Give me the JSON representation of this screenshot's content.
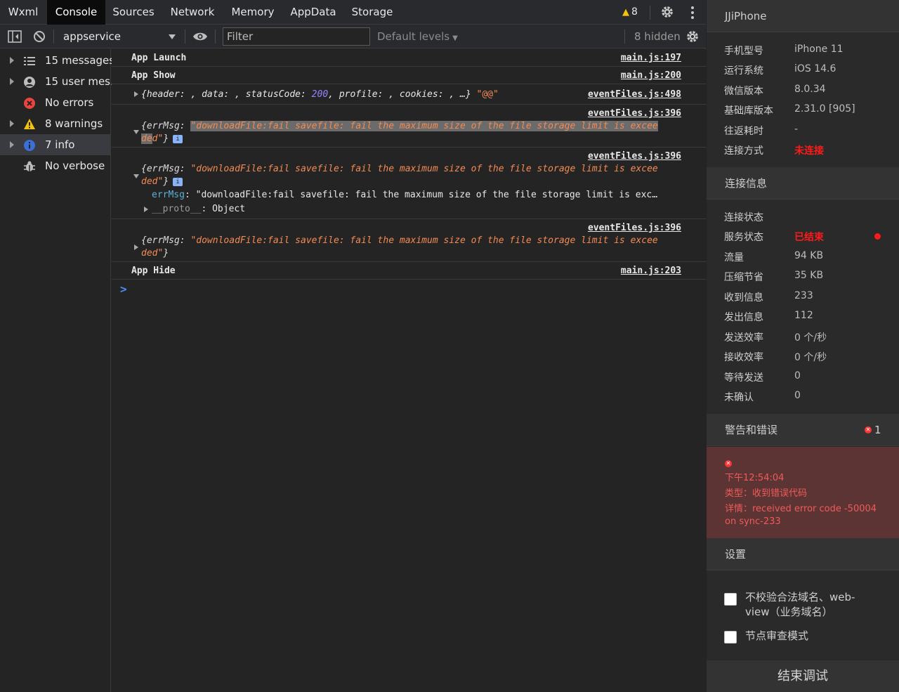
{
  "tabs": [
    "Wxml",
    "Console",
    "Sources",
    "Network",
    "Memory",
    "AppData",
    "Storage"
  ],
  "active_tab": "Console",
  "warning_count": "8",
  "toolbar": {
    "context": "appservice",
    "filter_placeholder": "Filter",
    "levels": "Default levels",
    "hidden": "8 hidden"
  },
  "sidebar": [
    {
      "label": "15 messages",
      "icon": "list-icon"
    },
    {
      "label": "15 user mes...",
      "icon": "user-icon"
    },
    {
      "label": "No errors",
      "icon": "error-icon"
    },
    {
      "label": "8 warnings",
      "icon": "warning-icon"
    },
    {
      "label": "7 info",
      "icon": "info-icon"
    },
    {
      "label": "No verbose",
      "icon": "bug-icon"
    }
  ],
  "log": {
    "launch": {
      "text": "App Launch",
      "src": "main.js:197"
    },
    "show": {
      "text": "App Show",
      "src": "main.js:200"
    },
    "obj": {
      "k1": "header",
      "k2": "data",
      "k3": "statusCode",
      "v3": "200",
      "k4": "profile",
      "k5": "cookies",
      "ell": "…",
      "str": "\"@@\"",
      "src": "eventFiles.js:498"
    },
    "err1": {
      "src": "eventFiles.js:396",
      "key": "{errMsg: ",
      "line1": "\"downloadFile:fail savefile: fail the maximum size of the file storage limit is excee",
      "line2a": "de",
      "line2b": "d\"",
      "close": "}",
      "badge": "i"
    },
    "err2": {
      "src": "eventFiles.js:396",
      "key": "{errMsg: ",
      "line1": "\"downloadFile:fail savefile: fail the maximum size of the file storage limit is excee",
      "line2": "ded\"",
      "close": "}",
      "badge": "i",
      "prop_key": "errMsg",
      "prop_val": "\"downloadFile:fail savefile: fail the maximum size of the file storage limit is exc…",
      "proto_key": "__proto__",
      "proto_val": "Object"
    },
    "err3": {
      "src": "eventFiles.js:396",
      "key": "{errMsg: ",
      "line1": "\"downloadFile:fail savefile: fail the maximum size of the file storage limit is excee",
      "line2": "ded\"",
      "close": "}"
    },
    "hide": {
      "text": "App Hide",
      "src": "main.js:203"
    },
    "prompt": ">"
  },
  "panel": {
    "device_title": "JJiPhone",
    "device_info": [
      {
        "k": "手机型号",
        "v": "iPhone 11"
      },
      {
        "k": "运行系统",
        "v": "iOS 14.6"
      },
      {
        "k": "微信版本",
        "v": "8.0.34"
      },
      {
        "k": "基础库版本",
        "v": "2.31.0 [905]"
      },
      {
        "k": "往返耗时",
        "v": "-"
      },
      {
        "k": "连接方式",
        "v": "未连接"
      }
    ],
    "conn_title": "连接信息",
    "conn_info": [
      {
        "k": "连接状态",
        "v": ""
      },
      {
        "k": "服务状态",
        "v": "已结束"
      },
      {
        "k": "流量",
        "v": "94 KB"
      },
      {
        "k": "压缩节省",
        "v": "35 KB"
      },
      {
        "k": "收到信息",
        "v": "233"
      },
      {
        "k": "发出信息",
        "v": "112"
      },
      {
        "k": "发送效率",
        "v": "0 个/秒"
      },
      {
        "k": "接收效率",
        "v": "0 个/秒"
      },
      {
        "k": "等待发送",
        "v": "0"
      },
      {
        "k": "未确认",
        "v": "0"
      }
    ],
    "warn_title": "警告和错误",
    "warn_count": "1",
    "error": {
      "time": "下午12:54:04",
      "type": "类型：收到错误代码",
      "detail1": "详情：received error code -50004",
      "detail2": "on sync-233"
    },
    "settings_title": "设置",
    "option1a": "不校验合法域名、web-",
    "option1b": "view（业务域名）",
    "option2": "节点审查模式",
    "end_button": "结束调试"
  },
  "colors": {
    "accent": "#4d8df5",
    "error": "#ff1a1a",
    "string": "#f28b54",
    "number": "#9980ff"
  }
}
